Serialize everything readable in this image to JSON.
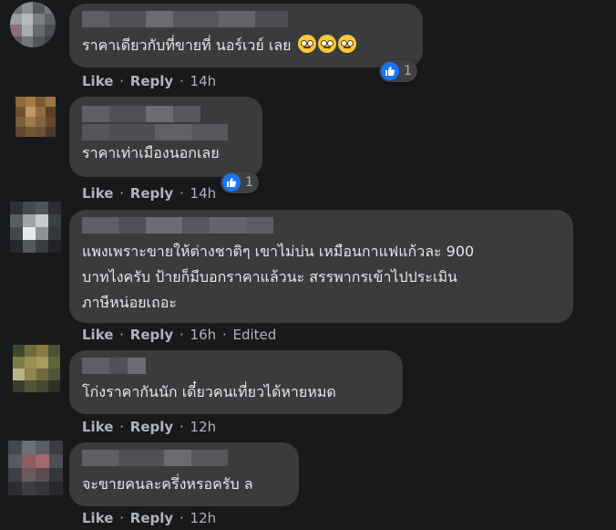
{
  "comments": [
    {
      "text": "ราคาเดียวกับที่ขายที่ นอร์เวย์ เลย",
      "emoji": [
        "face-with-rolling-eyes",
        "face-with-rolling-eyes",
        "face-with-rolling-eyes"
      ],
      "like_label": "Like",
      "reply_label": "Reply",
      "time": "14h",
      "reaction_count": "1"
    },
    {
      "text": "ราคาเท่าเมืองนอกเลย",
      "like_label": "Like",
      "reply_label": "Reply",
      "time": "14h",
      "reaction_count": "1"
    },
    {
      "text": "แพงเพราะขายให้ต่างชาติๆ เขาไม่บ่น เหมือนกาแฟแก้วละ 900\nบาทไงครับ ป้ายก็มีบอกราคาแล้วนะ สรรพากรเข้าไปประเมิน\nภาษีหน่อยเถอะ",
      "like_label": "Like",
      "reply_label": "Reply",
      "time": "16h",
      "edited": "Edited"
    },
    {
      "text": "โก่งราคากันนัก เดี๋ยวคนเที่ยวได้หายหมด",
      "like_label": "Like",
      "reply_label": "Reply",
      "time": "12h"
    },
    {
      "text": "จะขายคนละครึ่งหรอครับ ล",
      "like_label": "Like",
      "reply_label": "Reply",
      "time": "12h"
    }
  ],
  "colors": {
    "background": "#18191a",
    "bubble": "#3a3b3c",
    "text": "#e4e6eb",
    "secondary_text": "#b0b3b8",
    "like_blue": "#1877f2"
  }
}
